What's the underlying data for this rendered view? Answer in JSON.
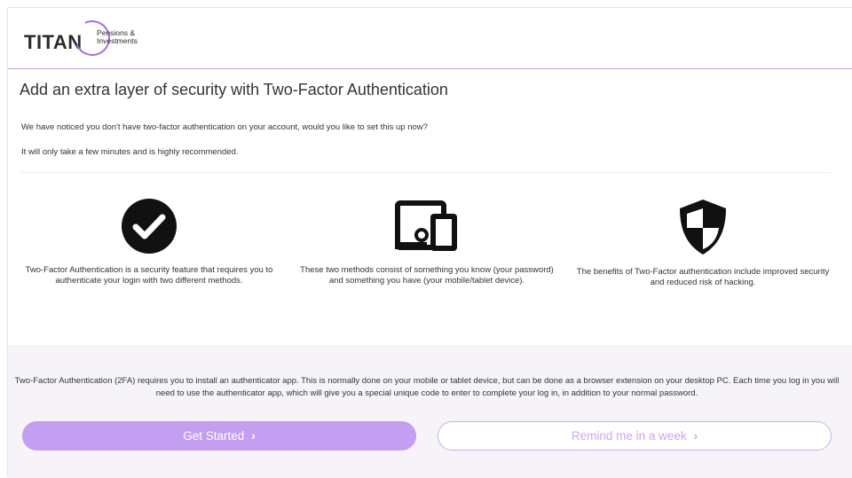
{
  "brand": {
    "name": "TITAN",
    "tagline": "Pensions & Investments",
    "accent": "#a86ce0"
  },
  "page": {
    "title": "Add an extra layer of security with Two-Factor Authentication",
    "intro": "We have noticed you don't have two-factor authentication on your account, would you like to set this up now?",
    "note": "It will only take a few minutes and is highly recommended."
  },
  "features": [
    {
      "icon": "check-circle-icon",
      "text": "Two-Factor Authentication is a security feature that requires you to authenticate your login with two different methods."
    },
    {
      "icon": "devices-icon",
      "text": "These two methods consist of something you know (your password) and something you have (your mobile/tablet device)."
    },
    {
      "icon": "shield-icon",
      "text": "The benefits of Two-Factor authentication include improved security and reduced risk of hacking."
    }
  ],
  "info": {
    "text": "Two-Factor Authentication (2FA) requires you to install an authenticator app. This is normally done on your mobile or tablet device, but can be done as a browser extension on your desktop PC. Each time you log in you will need to use the authenticator app, which will give you a special unique code to enter to complete your log in, in addition to your normal password."
  },
  "actions": {
    "primary_label": "Get Started",
    "secondary_label": "Remind me in a week",
    "chevron": "›"
  },
  "colors": {
    "primary_button": "#c49ef0",
    "secondary_border": "#c9b0ec",
    "band": "#f6f4f9"
  }
}
